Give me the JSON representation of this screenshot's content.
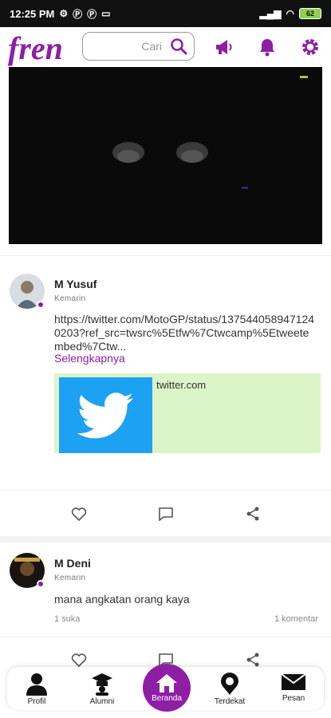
{
  "status_bar": {
    "time": "12:25 PM",
    "battery": "62"
  },
  "header": {
    "logo_text": "fren",
    "search_placeholder": "Cari",
    "icons": [
      "megaphone-icon",
      "bell-icon",
      "gear-icon"
    ]
  },
  "colors": {
    "brand": "#8e1fa5",
    "link_card_bg": "#dcf5c8",
    "twitter_blue": "#1da1f2"
  },
  "posts": [
    {
      "author": "M Yusuf",
      "time": "Kemarin",
      "text": "https://twitter.com/MotoGP/status/1375440589471240203?ref_src=twsrc%5Etfw%7Ctwcamp%5Etweetembed%7Ctw...",
      "more_label": "Selengkapnya",
      "link_domain": "twitter.com"
    },
    {
      "author": "M Deni",
      "time": "Kemarin",
      "text": "mana angkatan orang kaya",
      "likes": "1 suka",
      "comments": "1 komentar"
    }
  ],
  "bottom_nav": [
    {
      "label": "Profil",
      "icon": "person-icon"
    },
    {
      "label": "Alumni",
      "icon": "graduation-icon"
    },
    {
      "label": "Beranda",
      "icon": "home-icon",
      "active": true
    },
    {
      "label": "Terdekat",
      "icon": "location-pin-icon"
    },
    {
      "label": "Pesan",
      "icon": "envelope-icon"
    }
  ]
}
